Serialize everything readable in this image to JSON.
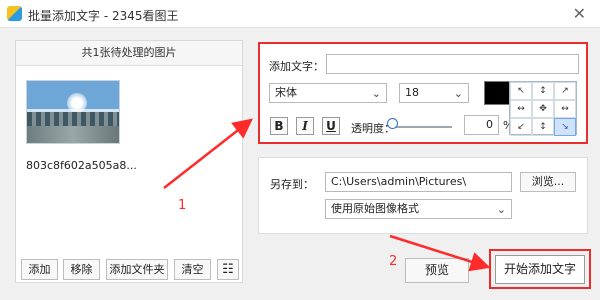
{
  "window": {
    "title": "批量添加文字 - 2345看图王",
    "close_symbol": "✕",
    "icon": "app-logo-icon"
  },
  "left_panel": {
    "header": "共1张待处理的图片",
    "image_name": "803c8f602a505a8...",
    "buttons": {
      "add": "添加",
      "remove": "移除",
      "add_folder": "添加文件夹",
      "clear": "清空"
    },
    "list_icon": "list-view-icon"
  },
  "text_settings": {
    "add_text_label": "添加文字：",
    "text_value": "",
    "font": "宋体",
    "size": "18",
    "color": "#000000",
    "bold": "B",
    "italic": "I",
    "underline": "U",
    "opacity_label": "透明度：",
    "opacity_value": "0",
    "opacity_unit": "%",
    "positions": [
      "↖",
      "↕",
      "↗",
      "↔",
      "✥",
      "↔",
      "↙",
      "↕",
      "↘"
    ],
    "selected_position": "bottom-right"
  },
  "save_settings": {
    "save_to_label": "另存到：",
    "path": "C:\\Users\\admin\\Pictures\\",
    "browse": "浏览...",
    "format": "使用原始图像格式"
  },
  "annotations": {
    "one": "1",
    "two": "2",
    "color": "#ff2b2b"
  },
  "actions": {
    "preview": "预览",
    "start": "开始添加文字"
  }
}
